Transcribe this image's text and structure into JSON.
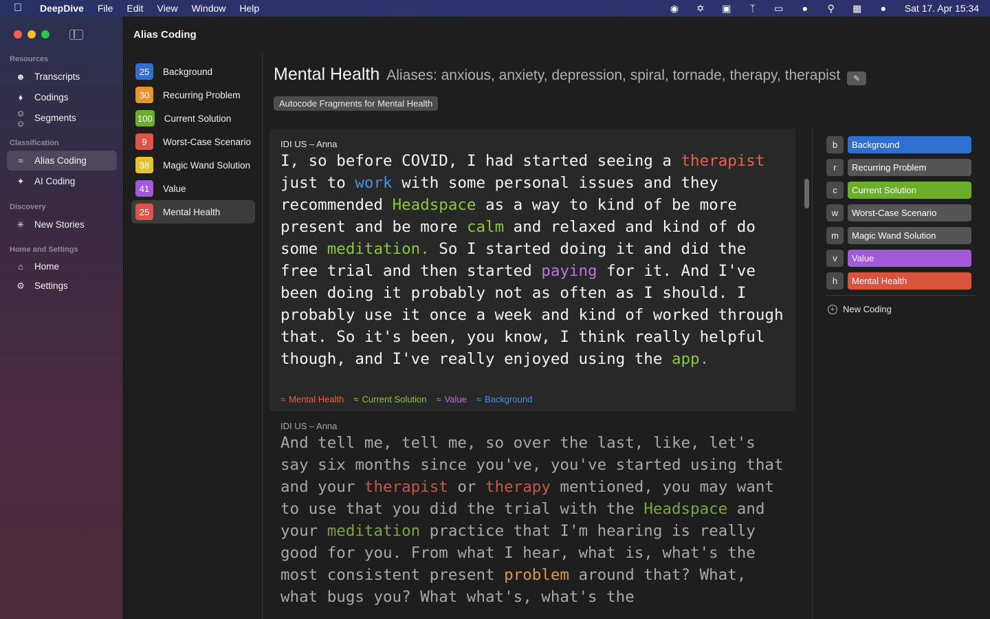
{
  "menubar": {
    "app_name": "DeepDive",
    "menus": [
      "File",
      "Edit",
      "View",
      "Window",
      "Help"
    ],
    "clock": "Sat 17. Apr  15:34"
  },
  "sidebar": {
    "sections": [
      {
        "title": "Resources",
        "items": [
          "Transcripts",
          "Codings",
          "Segments"
        ]
      },
      {
        "title": "Classification",
        "items": [
          "Alias Coding",
          "AI Coding"
        ]
      },
      {
        "title": "Discovery",
        "items": [
          "New Stories"
        ]
      },
      {
        "title": "Home and Settings",
        "items": [
          "Home",
          "Settings"
        ]
      }
    ],
    "active": "Alias Coding"
  },
  "page": {
    "title": "Alias Coding"
  },
  "codings": [
    {
      "count": "25",
      "name": "Background",
      "color": "#2f6fd1"
    },
    {
      "count": "30",
      "name": "Recurring Problem",
      "color": "#e8922f"
    },
    {
      "count": "100",
      "name": "Current Solution",
      "color": "#6aae2a"
    },
    {
      "count": "9",
      "name": "Worst-Case Scenario",
      "color": "#e0534a"
    },
    {
      "count": "38",
      "name": "Magic Wand Solution",
      "color": "#e6c32a"
    },
    {
      "count": "41",
      "name": "Value",
      "color": "#a25ad8"
    },
    {
      "count": "25",
      "name": "Mental Health",
      "color": "#e0534a"
    }
  ],
  "detail": {
    "title": "Mental Health",
    "aliases": "Aliases: anxious, anxiety, depression, spiral, tornade, therapy, therapist",
    "autocode_label": "Autocode Fragments for Mental Health"
  },
  "fragments": [
    {
      "source": "IDI US – Anna",
      "segments": [
        {
          "t": "I, so before COVID, I had started seeing a ",
          "c": ""
        },
        {
          "t": "therapist",
          "c": "hl-red"
        },
        {
          "t": " just to ",
          "c": ""
        },
        {
          "t": "work",
          "c": "hl-blue"
        },
        {
          "t": " with some personal issues and they recommended ",
          "c": ""
        },
        {
          "t": "Headspace",
          "c": "hl-green"
        },
        {
          "t": " as a way to kind of be more present and be more ",
          "c": ""
        },
        {
          "t": "calm",
          "c": "hl-green"
        },
        {
          "t": " and relaxed and kind of do some ",
          "c": ""
        },
        {
          "t": "meditation.",
          "c": "hl-green"
        },
        {
          "t": " So I started doing it and did the free trial and then started ",
          "c": ""
        },
        {
          "t": "paying",
          "c": "hl-purple"
        },
        {
          "t": " for it. And I've been doing it probably not as often as I should. I probably use it once a week and kind of worked through that. So it's been, you know, I think really helpful though, and I've really enjoyed using the ",
          "c": ""
        },
        {
          "t": "app.",
          "c": "hl-green"
        }
      ],
      "tags": [
        {
          "name": "Mental Health",
          "color": "#e8634a"
        },
        {
          "name": "Current Solution",
          "color": "#8ec63f"
        },
        {
          "name": "Value",
          "color": "#c271e0"
        },
        {
          "name": "Background",
          "color": "#4a90e2"
        }
      ]
    },
    {
      "source": "IDI US – Anna",
      "segments": [
        {
          "t": "And tell me, tell me, so over the last, like, let's say six months since you've, you've started using that and your ",
          "c": ""
        },
        {
          "t": "therapist",
          "c": "dim-red"
        },
        {
          "t": " or ",
          "c": ""
        },
        {
          "t": "therapy",
          "c": "dim-red"
        },
        {
          "t": " mentioned, you may want to use that you did the trial with the ",
          "c": ""
        },
        {
          "t": "Headspace",
          "c": "dim-green"
        },
        {
          "t": " and your ",
          "c": ""
        },
        {
          "t": "meditation",
          "c": "dim-green"
        },
        {
          "t": " practice that I'm hearing is really good for you. From what I hear, what is, what's the most consistent present ",
          "c": ""
        },
        {
          "t": "problem",
          "c": "dim-orange"
        },
        {
          "t": " around that? What, what bugs you? What what's, what's the",
          "c": ""
        }
      ]
    }
  ],
  "legend": [
    {
      "key": "b",
      "name": "Background",
      "color": "#2f6fd1"
    },
    {
      "key": "r",
      "name": "Recurring Problem",
      "color": "#555555"
    },
    {
      "key": "c",
      "name": "Current Solution",
      "color": "#6aae2a"
    },
    {
      "key": "w",
      "name": "Worst-Case Scenario",
      "color": "#555555"
    },
    {
      "key": "m",
      "name": "Magic Wand Solution",
      "color": "#555555"
    },
    {
      "key": "v",
      "name": "Value",
      "color": "#a25ad8"
    },
    {
      "key": "h",
      "name": "Mental Health",
      "color": "#d9533f"
    }
  ],
  "new_coding_label": "New Coding"
}
